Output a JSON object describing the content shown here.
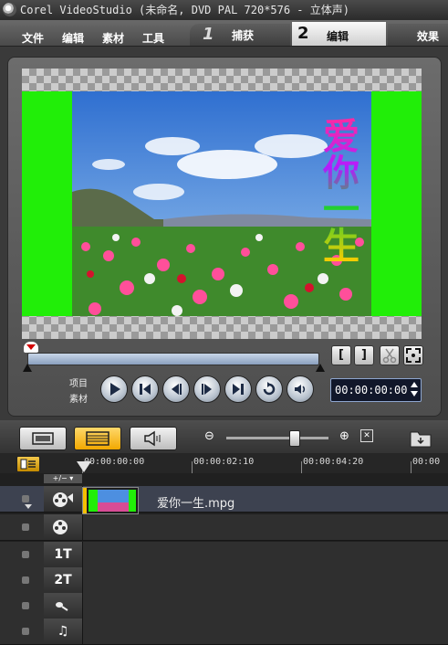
{
  "window": {
    "title": "Corel VideoStudio (未命名, DVD PAL 720*576 - 立体声)"
  },
  "menu": {
    "file": "文件",
    "edit": "编辑",
    "clip": "素材",
    "tools": "工具"
  },
  "steps": [
    {
      "number": "1",
      "label": "捕获"
    },
    {
      "number": "2",
      "label": "编辑"
    },
    {
      "label": "效果"
    }
  ],
  "preview": {
    "overlay_text": "爱你一生"
  },
  "player": {
    "mark_in": "[",
    "mark_out": "]",
    "mode_project": "项目",
    "mode_clip": "素材",
    "timecode": "00:00:00:00"
  },
  "timeline": {
    "ruler_ticks": [
      "00:00:00:00",
      "00:00:02:10",
      "00:00:04:20",
      "00:00"
    ],
    "clip": {
      "name": "爱你一生.mpg"
    },
    "track_labels": [
      "1T",
      "2T",
      "♫"
    ]
  },
  "colors": {
    "overlay_green": "#21ee08",
    "active_button": "#f2a800"
  }
}
